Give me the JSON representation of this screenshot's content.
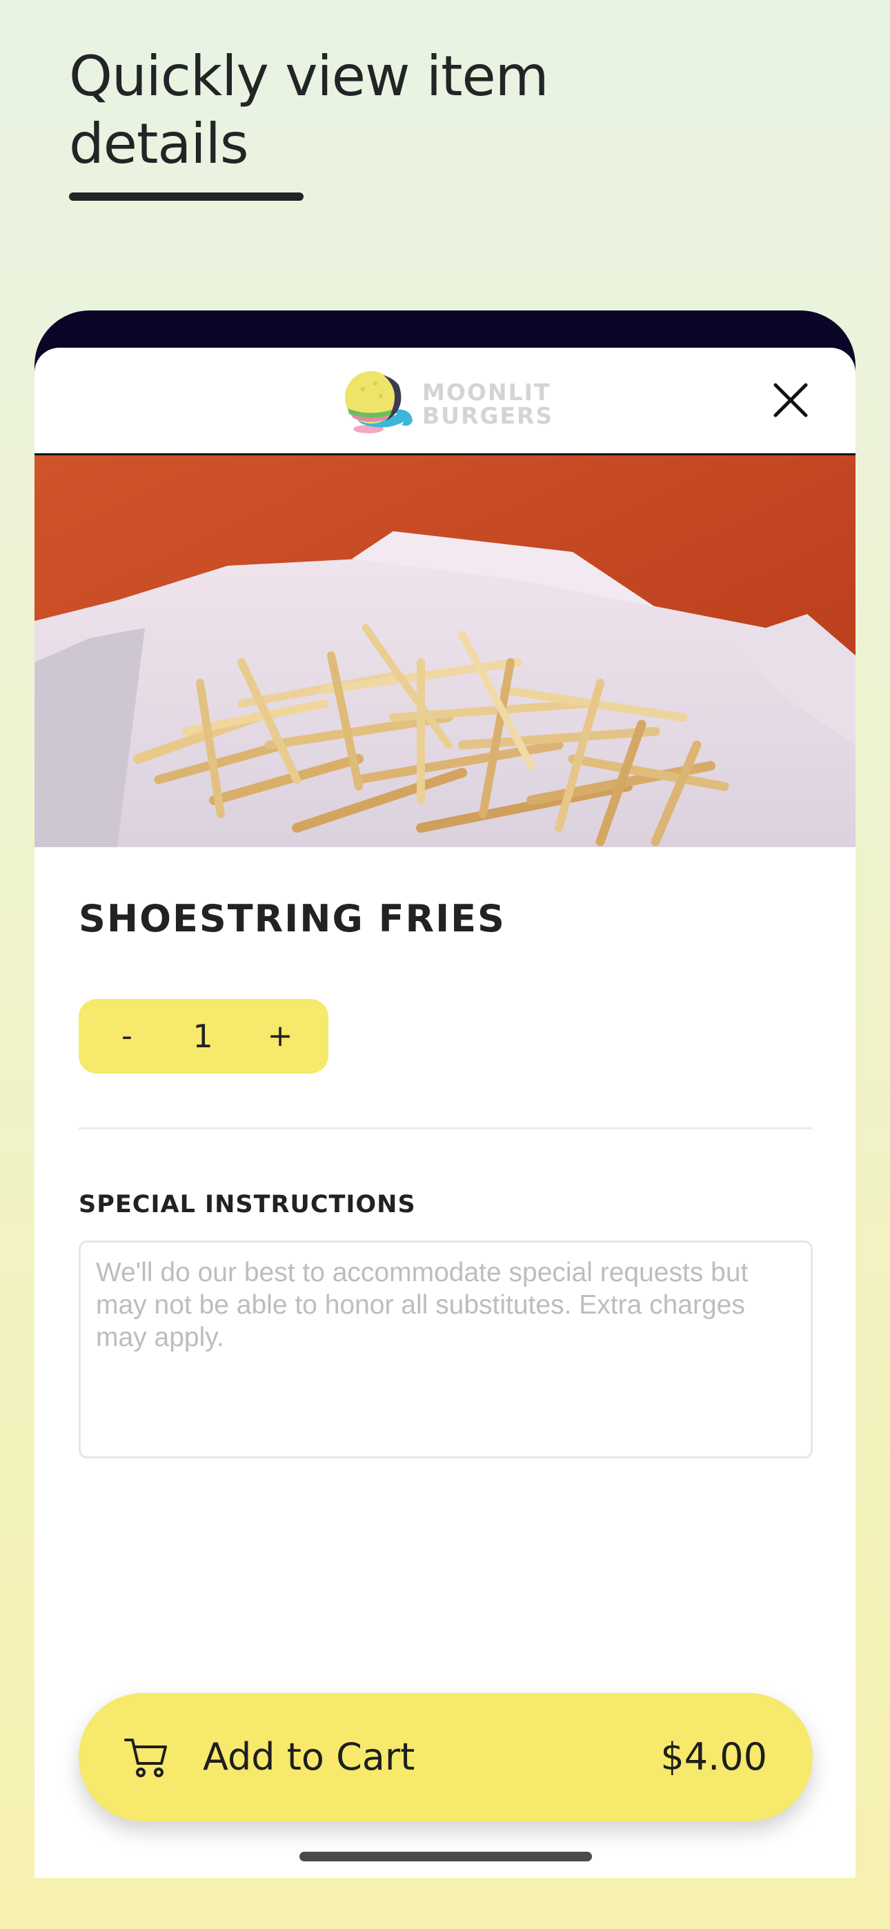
{
  "promo": {
    "headline": "Quickly view item details"
  },
  "header": {
    "logo_line1": "MOONLIT",
    "logo_line2": "BURGERS",
    "close_icon": "close-icon"
  },
  "item": {
    "image_icon": "shoestring-fries-photo",
    "name": "SHOESTRING FRIES",
    "quantity": "1",
    "decrement_label": "-",
    "increment_label": "+"
  },
  "special_instructions": {
    "label": "SPECIAL INSTRUCTIONS",
    "value": "",
    "placeholder": "We'll do our best to accommodate special requests but may not be able to honor all substitutes. Extra charges may apply."
  },
  "cart_button": {
    "icon": "cart-icon",
    "label": "Add to Cart",
    "price": "$4.00"
  },
  "colors": {
    "accent_yellow": "#f6e96b",
    "phone_frame": "#0b0528",
    "text_dark": "#222426",
    "image_background": "#c9451e"
  }
}
